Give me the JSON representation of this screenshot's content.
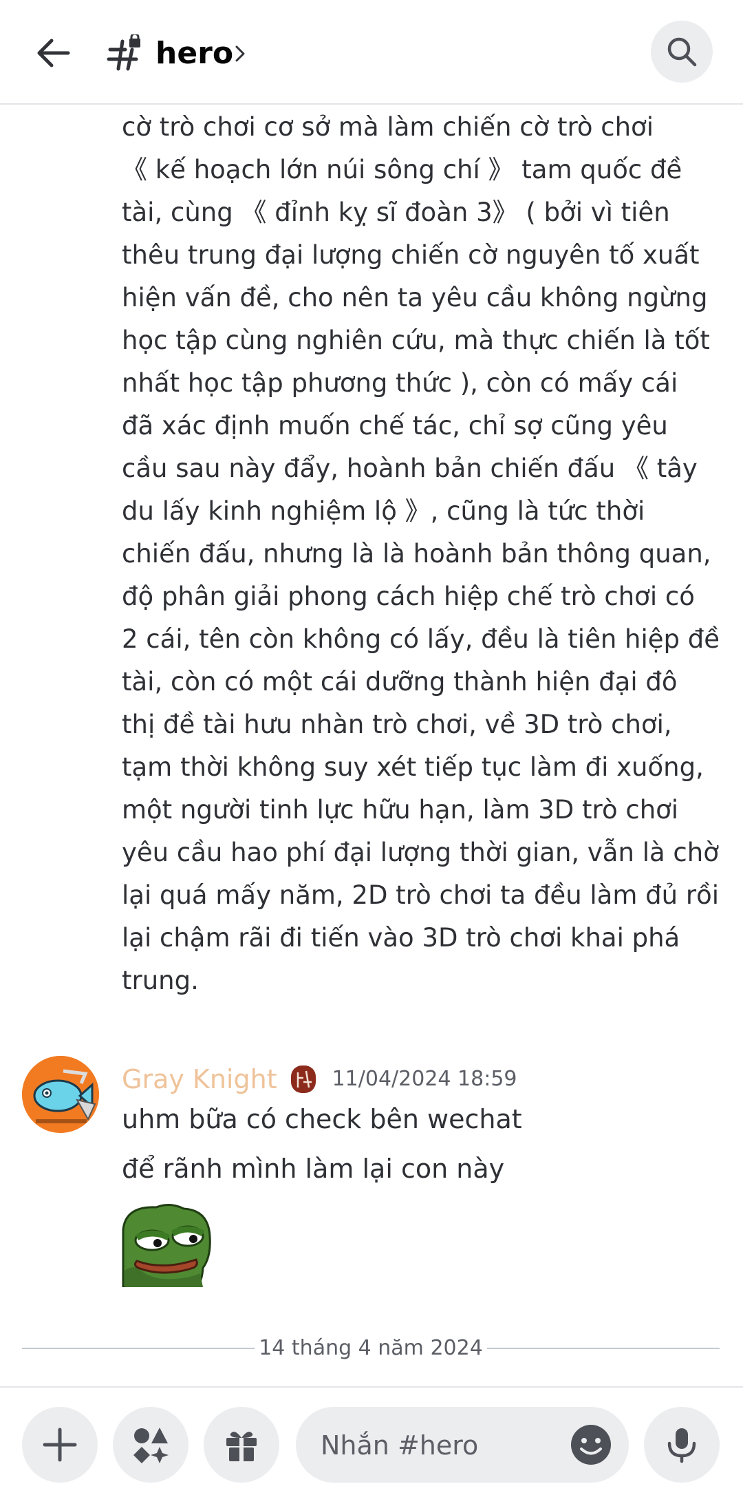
{
  "header": {
    "channel_name": "hero",
    "back_icon": "arrow-left-icon",
    "channel_icon": "locked-hash-icon",
    "search_icon": "search-icon"
  },
  "messages": {
    "continued_text": "cờ trò chơi cơ sở mà làm chiến cờ trò chơi\n《 kế hoạch lớn núi sông chí 》 tam quốc đề\ntài, cùng 《 đỉnh kỵ sĩ đoàn 3》 ( bởi vì tiên\nthêu trung đại lượng chiến cờ nguyên tố xuất\nhiện vấn đề, cho nên ta yêu cầu không ngừng\nhọc tập cùng nghiên cứu, mà thực chiến là tốt\nnhất học tập phương thức ), còn có mấy cái\nđã xác định muốn chế tác, chỉ sợ cũng yêu\ncầu sau này đẩy, hoành bản chiến đấu 《 tây\ndu lấy kinh nghiệm lộ 》, cũng là tức thời\nchiến đấu, nhưng là là hoành bản thông quan,\nđộ phân giải phong cách hiệp chế trò chơi có\n2 cái, tên còn không có lấy, đều là tiên hiệp đề\ntài, còn có một cái dưỡng thành hiện đại đô\nthị đề tài hưu nhàn trò chơi, về 3D trò chơi,\ntạm thời không suy xét tiếp tục làm đi xuống,\nmột người tinh lực hữu hạn, làm 3D trò chơi\nyêu cầu hao phí đại lượng thời gian, vẫn là chờ\nlại quá mấy năm, 2D trò chơi ta đều làm đủ rồi\nlại chậm rãi đi tiến vào 3D trò chơi khai phá\ntrung.",
    "author": {
      "name": "Gray Knight",
      "name_color": "#efc39a",
      "timestamp": "11/04/2024 18:59"
    },
    "lines": [
      "uhm bữa có check bên wechat",
      "để rãnh mình làm lại con này"
    ],
    "sticker": "pepe-frog-sticker",
    "date_divider": "14 tháng 4 năm 2024"
  },
  "composer": {
    "placeholder": "Nhắn #hero",
    "plus_icon": "plus-icon",
    "apps_icon": "apps-icon",
    "gift_icon": "gift-icon",
    "emoji_icon": "emoji-icon",
    "mic_icon": "microphone-icon"
  },
  "colors": {
    "text": "#2e3035",
    "muted": "#5c5e66",
    "button_bg": "#ebedef"
  }
}
